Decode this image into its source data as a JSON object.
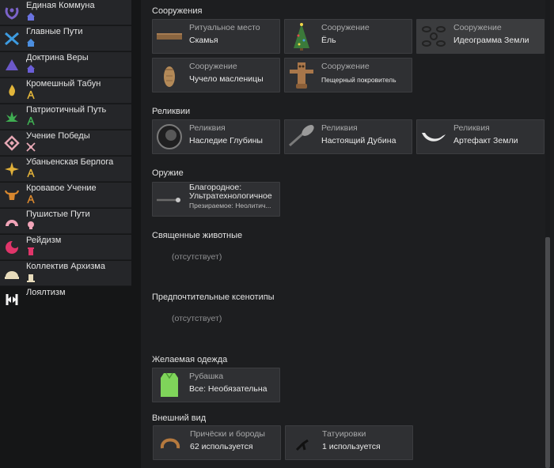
{
  "sidebar": {
    "items": [
      {
        "label": "Единая Коммуна",
        "icon": "wreath-icon",
        "sub_icon": "house-icon",
        "color": "#7b63c9"
      },
      {
        "label": "Главные Пути",
        "icon": "crossed-arrows-icon",
        "sub_icon": "house-icon",
        "color": "#3d9be0"
      },
      {
        "label": "Доктрина Веры",
        "icon": "triangle-icon",
        "sub_icon": "house-icon",
        "color": "#6b58c8"
      },
      {
        "label": "Кромешный Табун",
        "icon": "flame-icon",
        "sub_icon": "compass-icon",
        "color": "#e2b53a"
      },
      {
        "label": "Патриотичный Путь",
        "icon": "leaf-icon",
        "sub_icon": "compass-icon",
        "color": "#3fae52"
      },
      {
        "label": "Учение Победы",
        "icon": "diamond-icon",
        "sub_icon": "crossed-swords-icon",
        "color": "#e6a7b4"
      },
      {
        "label": "Убаньенская Берлога",
        "icon": "star-cross-icon",
        "sub_icon": "compass-icon",
        "color": "#e0b03a"
      },
      {
        "label": "Кровавое Учение",
        "icon": "bull-icon",
        "sub_icon": "compass-icon",
        "color": "#d8872e"
      },
      {
        "label": "Пушистые Пути",
        "icon": "fan-icon",
        "sub_icon": "skull-icon",
        "color": "#f1a4b8"
      },
      {
        "label": "Рейдизм",
        "icon": "moon-icon",
        "sub_icon": "tower-icon",
        "color": "#e0356a"
      },
      {
        "label": "Коллектив Архизма",
        "icon": "dome-icon",
        "sub_icon": "pillar-icon",
        "color": "#e8dcbc"
      },
      {
        "label": "Лоялтизм",
        "icon": "banner-icon",
        "sub_icon": "",
        "color": "#f2f2f2"
      }
    ]
  },
  "sections": {
    "buildings": {
      "title": "Сооружения",
      "cards": [
        {
          "type": "Ритуальное место",
          "name": "Скамья",
          "icon": "bench-icon"
        },
        {
          "type": "Сооружение",
          "name": "Ёль",
          "icon": "christmas-tree-icon"
        },
        {
          "type": "Сооружение",
          "name": "Идеограмма Земли",
          "icon": "ideogram-icon"
        },
        {
          "type": "Сооружение",
          "name": "Чучело масленицы",
          "icon": "effigy-icon"
        },
        {
          "type": "Сооружение",
          "name": "Пещерный покровитель",
          "icon": "totem-icon"
        }
      ]
    },
    "relics": {
      "title": "Реликвии",
      "cards": [
        {
          "type": "Реликвия",
          "name": "Наследие Глубины",
          "icon": "orb-icon"
        },
        {
          "type": "Реликвия",
          "name": "Настоящий Дубина",
          "icon": "club-icon"
        },
        {
          "type": "Реликвия",
          "name": "Артефакт Земли",
          "icon": "horn-icon"
        }
      ]
    },
    "weapons": {
      "title": "Оружие",
      "card": {
        "type": "Благородное: Ультратехнологичное",
        "name": "Презираемое: Неолитич...",
        "icon": "staff-icon"
      }
    },
    "animals": {
      "title": "Священные животные",
      "absent": "(отсутствует)"
    },
    "xenotypes": {
      "title": "Предпочтительные ксенотипы",
      "absent": "(отсутствует)"
    },
    "apparel": {
      "title": "Желаемая одежда",
      "card": {
        "type": "Рубашка",
        "name": "Все: Необязательна",
        "icon": "shirt-icon"
      }
    },
    "appearance": {
      "title": "Внешний вид",
      "cards": [
        {
          "type": "Причёски и бороды",
          "name": "62 используется",
          "icon": "hair-icon"
        },
        {
          "type": "Татуировки",
          "name": "1 используется",
          "icon": "tattoo-icon"
        }
      ]
    }
  }
}
